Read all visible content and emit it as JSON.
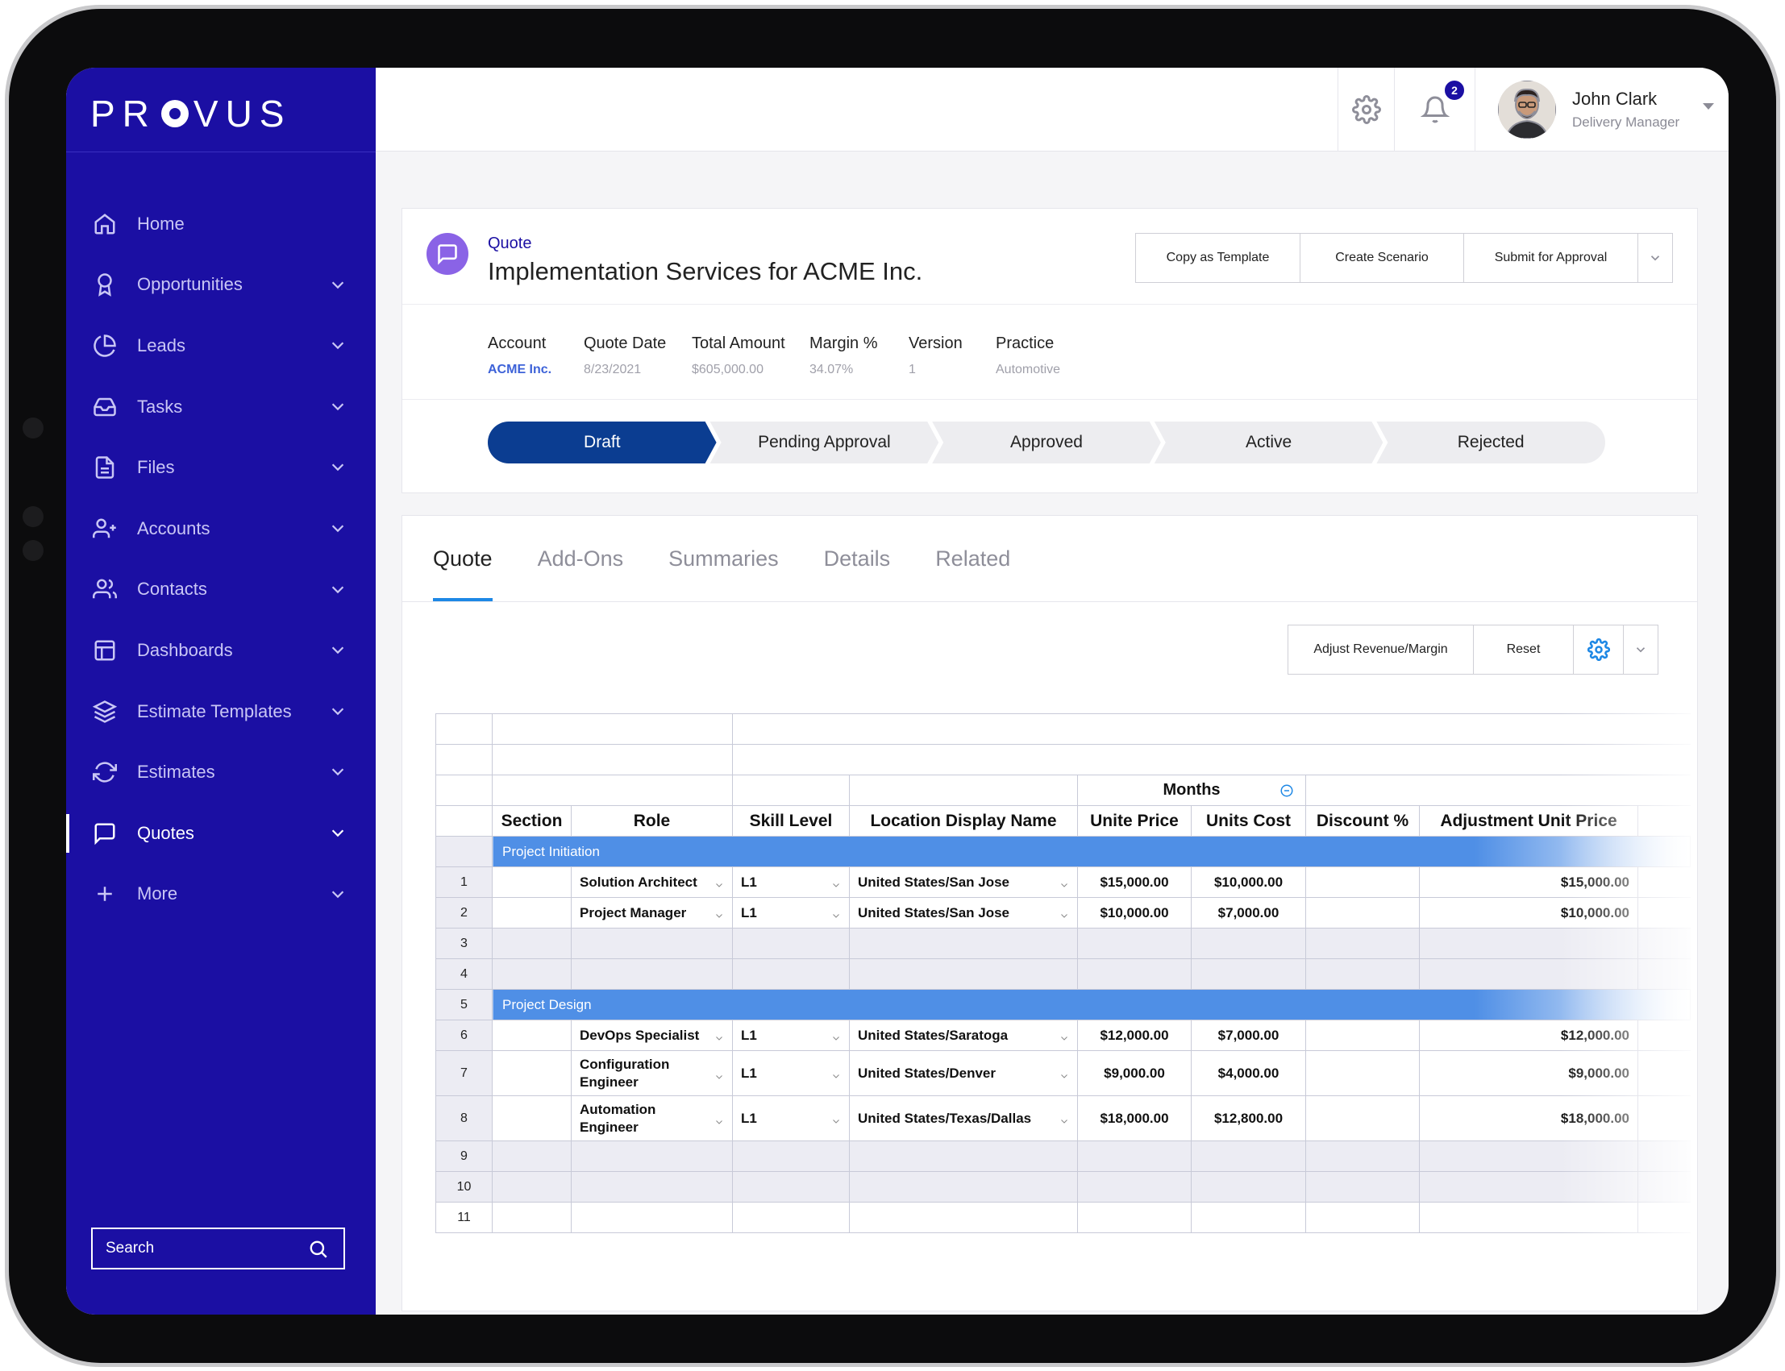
{
  "app": {
    "logo": "PROVUS",
    "logo_left": "PR",
    "logo_right": "VUS"
  },
  "sidebar": {
    "items": [
      {
        "label": "Home",
        "icon": "home-icon",
        "has_chevron": false
      },
      {
        "label": "Opportunities",
        "icon": "award-icon",
        "has_chevron": true
      },
      {
        "label": "Leads",
        "icon": "pie-chart-icon",
        "has_chevron": true
      },
      {
        "label": "Tasks",
        "icon": "inbox-icon",
        "has_chevron": true
      },
      {
        "label": "Files",
        "icon": "file-icon",
        "has_chevron": true
      },
      {
        "label": "Accounts",
        "icon": "user-plus-icon",
        "has_chevron": true
      },
      {
        "label": "Contacts",
        "icon": "users-icon",
        "has_chevron": true
      },
      {
        "label": "Dashboards",
        "icon": "layout-icon",
        "has_chevron": true
      },
      {
        "label": "Estimate Templates",
        "icon": "layers-icon",
        "has_chevron": true
      },
      {
        "label": "Estimates",
        "icon": "refresh-icon",
        "has_chevron": true
      },
      {
        "label": "Quotes",
        "icon": "message-square-icon",
        "has_chevron": true,
        "active": true
      },
      {
        "label": "More",
        "icon": "plus-icon",
        "has_chevron": true
      }
    ],
    "search_label": "Search"
  },
  "topbar": {
    "notification_count": "2",
    "user_name": "John Clark",
    "user_role": "Delivery Manager"
  },
  "quote": {
    "kicker": "Quote",
    "title": "Implementation Services for ACME Inc.",
    "actions": {
      "copy_template": "Copy as Template",
      "create_scenario": "Create Scenario",
      "submit_approval": "Submit for Approval"
    },
    "meta": [
      {
        "label": "Account",
        "value": "ACME Inc.",
        "link": true
      },
      {
        "label": "Quote Date",
        "value": "8/23/2021"
      },
      {
        "label": "Total Amount",
        "value": "$605,000.00"
      },
      {
        "label": "Margin %",
        "value": "34.07%"
      },
      {
        "label": "Version",
        "value": "1"
      },
      {
        "label": "Practice",
        "value": "Automotive"
      }
    ],
    "stages": [
      {
        "label": "Draft",
        "active": true
      },
      {
        "label": "Pending Approval"
      },
      {
        "label": "Approved"
      },
      {
        "label": "Active"
      },
      {
        "label": "Rejected"
      }
    ]
  },
  "tabs": [
    {
      "label": "Quote",
      "active": true
    },
    {
      "label": "Add-Ons"
    },
    {
      "label": "Summaries"
    },
    {
      "label": "Details"
    },
    {
      "label": "Related"
    }
  ],
  "grid_toolbar": {
    "adjust": "Adjust Revenue/Margin",
    "reset": "Reset"
  },
  "grid": {
    "group_header": "Months",
    "columns": [
      "Section",
      "Role",
      "Skill Level",
      "Location Display Name",
      "Unite Price",
      "Units Cost",
      "Discount %",
      "Adjustment Unit Price"
    ],
    "rows": [
      {
        "type": "section",
        "label": "Project Initiation"
      },
      {
        "type": "data",
        "n": "1",
        "role": "Solution Architect",
        "skill": "L1",
        "location": "United States/San Jose",
        "price": "$15,000.00",
        "cost": "$10,000.00",
        "discount": "",
        "adj": "$15,000.00"
      },
      {
        "type": "data",
        "n": "2",
        "role": "Project Manager",
        "skill": "L1",
        "location": "United States/San Jose",
        "price": "$10,000.00",
        "cost": "$7,000.00",
        "discount": "",
        "adj": "$10,000.00"
      },
      {
        "type": "empty",
        "n": "3"
      },
      {
        "type": "empty",
        "n": "4"
      },
      {
        "type": "section",
        "n": "5",
        "label": "Project Design"
      },
      {
        "type": "data",
        "n": "6",
        "role": "DevOps Specialist",
        "skill": "L1",
        "location": "United States/Saratoga",
        "price": "$12,000.00",
        "cost": "$7,000.00",
        "discount": "",
        "adj": "$12,000.00"
      },
      {
        "type": "data",
        "n": "7",
        "role": "Configuration Engineer",
        "skill": "L1",
        "location": "United States/Denver",
        "price": "$9,000.00",
        "cost": "$4,000.00",
        "discount": "",
        "adj": "$9,000.00",
        "tall": true
      },
      {
        "type": "data",
        "n": "8",
        "role": "Automation Engineer",
        "skill": "L1",
        "location": "United States/Texas/Dallas",
        "price": "$18,000.00",
        "cost": "$12,800.00",
        "discount": "",
        "adj": "$18,000.00",
        "tall": true
      },
      {
        "type": "empty",
        "n": "9"
      },
      {
        "type": "empty",
        "n": "10"
      },
      {
        "type": "blank",
        "n": "11"
      }
    ]
  },
  "colors": {
    "sidebar": "#1b0fa3",
    "stage_active": "#0b3d91",
    "section_band": "#4f8fe6",
    "tab_underline": "#1e88e5"
  }
}
